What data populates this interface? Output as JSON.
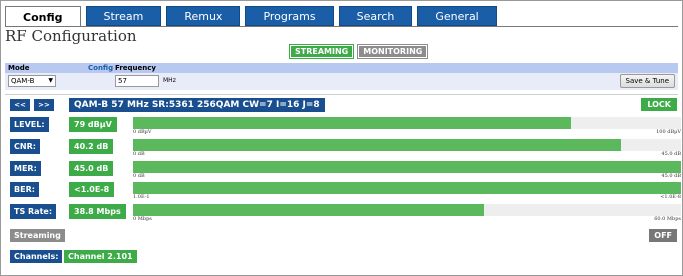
{
  "tabs": [
    {
      "label": "Config",
      "active": true
    },
    {
      "label": "Stream",
      "active": false
    },
    {
      "label": "Remux",
      "active": false
    },
    {
      "label": "Programs",
      "active": false
    },
    {
      "label": "Search",
      "active": false
    },
    {
      "label": "General",
      "active": false
    }
  ],
  "page_title": "RF Configuration",
  "badges": {
    "streaming": "STREAMING",
    "monitoring": "MONITORING"
  },
  "config": {
    "mode_header": "Mode",
    "config_link": "Config",
    "frequency_header": "Frequency",
    "mode_value": "QAM-B",
    "frequency_value": "57",
    "frequency_unit": "MHz",
    "save_button": "Save & Tune"
  },
  "nav": {
    "prev": "<<",
    "next": ">>"
  },
  "summary": "QAM-B 57 MHz SR:5361 256QAM CW=7 I=16 J=8",
  "lock": "LOCK",
  "metrics": [
    {
      "label": "LEVEL:",
      "value": "79 dBµV",
      "fill_pct": 80,
      "scale_lo": "0 dBµV",
      "scale_hi": "100 dBµV"
    },
    {
      "label": "CNR:",
      "value": "40.2 dB",
      "fill_pct": 89,
      "scale_lo": "0 dB",
      "scale_hi": "45.0 dB"
    },
    {
      "label": "MER:",
      "value": "45.0 dB",
      "fill_pct": 100,
      "scale_lo": "0 dB",
      "scale_hi": "45.0 dB"
    },
    {
      "label": "BER:",
      "value": "<1.0E-8",
      "fill_pct": 100,
      "scale_lo": "1.0E-1",
      "scale_hi": "<1.0E-8"
    },
    {
      "label": "TS Rate:",
      "value": "38.8 Mbps",
      "fill_pct": 64,
      "scale_lo": "0 Mbps",
      "scale_hi": "60.0 Mbps"
    }
  ],
  "streaming": {
    "label": "Streaming",
    "state": "OFF"
  },
  "channels": {
    "label": "Channels:",
    "value": "Channel 2.101"
  },
  "colors": {
    "nav_blue": "#1a4f8f",
    "tab_blue": "#1a5ea8",
    "status_green": "#3dab48",
    "bar_green": "#5cb85c",
    "header_blue": "#b8c9f1"
  }
}
